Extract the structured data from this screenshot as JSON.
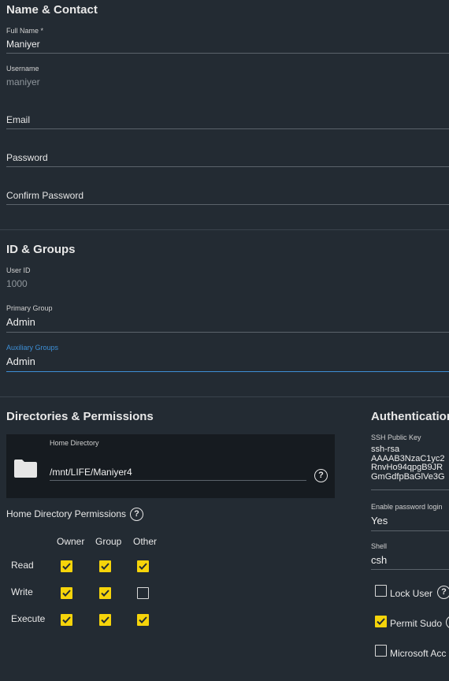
{
  "sections": {
    "name_contact": "Name & Contact",
    "id_groups": "ID & Groups",
    "dirs_perms": "Directories & Permissions",
    "authentication": "Authentication"
  },
  "name_contact": {
    "full_name": {
      "label": "Full Name *",
      "value": "Maniyer"
    },
    "username": {
      "label": "Username",
      "value": "maniyer"
    },
    "email": {
      "placeholder": "Email"
    },
    "password": {
      "placeholder": "Password"
    },
    "confirm_password": {
      "placeholder": "Confirm Password"
    }
  },
  "id_groups": {
    "user_id": {
      "label": "User ID",
      "value": "1000"
    },
    "primary_group": {
      "label": "Primary Group",
      "value": "Admin"
    },
    "auxiliary_groups": {
      "label": "Auxiliary Groups",
      "value": "Admin"
    }
  },
  "directories": {
    "home_label": "Home Directory",
    "home_value": "/mnt/LIFE/Maniyer4",
    "perm_title": "Home Directory Permissions",
    "columns": [
      "Owner",
      "Group",
      "Other"
    ],
    "rows": [
      {
        "label": "Read",
        "checks": [
          true,
          true,
          true
        ]
      },
      {
        "label": "Write",
        "checks": [
          true,
          true,
          false
        ]
      },
      {
        "label": "Execute",
        "checks": [
          true,
          true,
          true
        ]
      }
    ]
  },
  "authentication": {
    "ssh_label": "SSH Public Key",
    "ssh_lines": [
      "ssh-rsa",
      "AAAAB3NzaC1yc2",
      "RnvHo94qpgB9JR",
      "GmGdfpBaGlVe3G"
    ],
    "password_login": {
      "label": "Enable password login",
      "value": "Yes"
    },
    "shell": {
      "label": "Shell",
      "value": "csh"
    },
    "lock_user": {
      "label": "Lock User",
      "checked": false
    },
    "permit_sudo": {
      "label": "Permit Sudo",
      "checked": true
    },
    "microsoft_account": {
      "label": "Microsoft Acc",
      "checked": false
    }
  },
  "colors": {
    "accent": "#f6d40a",
    "focus": "#3d8fd6",
    "background": "#232b33"
  }
}
